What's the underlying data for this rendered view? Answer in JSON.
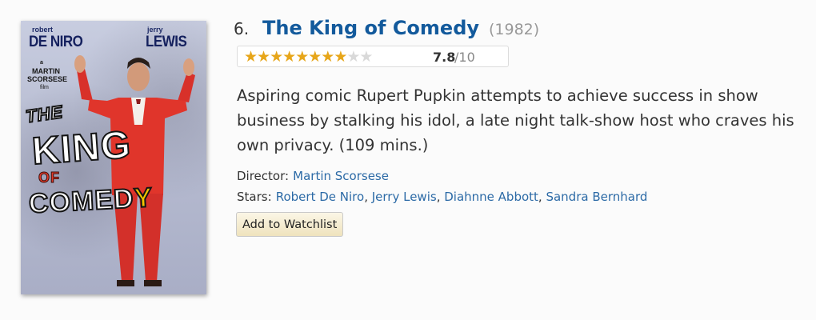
{
  "item": {
    "number": "6.",
    "title": "The King of Comedy",
    "year": "(1982)",
    "rating": {
      "value": "7.8",
      "max": "/10",
      "filled_stars": 7.8,
      "total_stars": 10
    },
    "description": "Aspiring comic Rupert Pupkin attempts to achieve success in show business by stalking his idol, a late night talk-show host who craves his own privacy. (109 mins.)",
    "director_label": "Director:",
    "director": "Martin Scorsese",
    "stars_label": "Stars:",
    "stars": [
      "Robert De Niro",
      "Jerry Lewis",
      "Diahnne Abbott",
      "Sandra Bernhard"
    ],
    "watchlist_label": "Add to Watchlist"
  },
  "poster": {
    "actor1_first": "robert",
    "actor1_last": "DE NIRO",
    "actor2_first": "jerry",
    "actor2_last": "LEWIS",
    "credit_a": "a",
    "director_first": "MARTIN",
    "director_last": "SCORSESE",
    "credit_film": "film",
    "title_the": "THE",
    "title_king": "KING",
    "title_of": "OF",
    "title_comedy_main": "COMED",
    "title_comedy_y": "Y"
  },
  "colors": {
    "title_link": "#135a9c",
    "link": "#2c6aa6",
    "star_on": "#e7a61a",
    "star_off": "#d9d9d9"
  }
}
